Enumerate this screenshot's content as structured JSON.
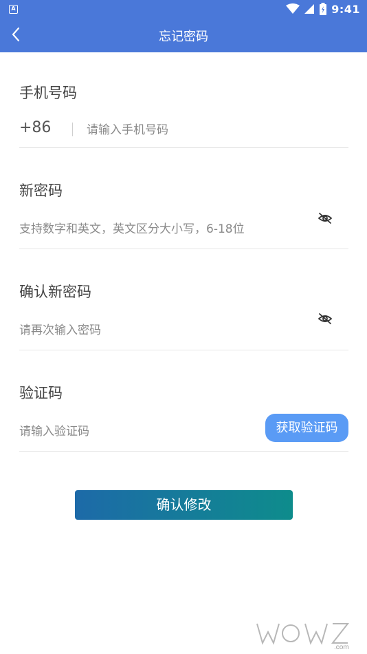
{
  "status_bar": {
    "time": "9:41",
    "notif_glyph": "A"
  },
  "header": {
    "title": "忘记密码",
    "back_icon": "chevron-left-icon"
  },
  "phone": {
    "label": "手机号码",
    "prefix": "+86",
    "placeholder": "请输入手机号码"
  },
  "new_password": {
    "label": "新密码",
    "placeholder": "支持数字和英文，英文区分大小写，6-18位",
    "toggle_icon": "eye-off-icon"
  },
  "confirm_password": {
    "label": "确认新密码",
    "placeholder": "请再次输入密码",
    "toggle_icon": "eye-off-icon"
  },
  "verify": {
    "label": "验证码",
    "placeholder": "请输入验证码",
    "button": "获取验证码"
  },
  "submit": {
    "label": "确认修改"
  },
  "colors": {
    "header": "#4a78d9",
    "code_button": "#5a9bf5",
    "submit_start": "#1d6aa8",
    "submit_end": "#0e8c8c"
  }
}
